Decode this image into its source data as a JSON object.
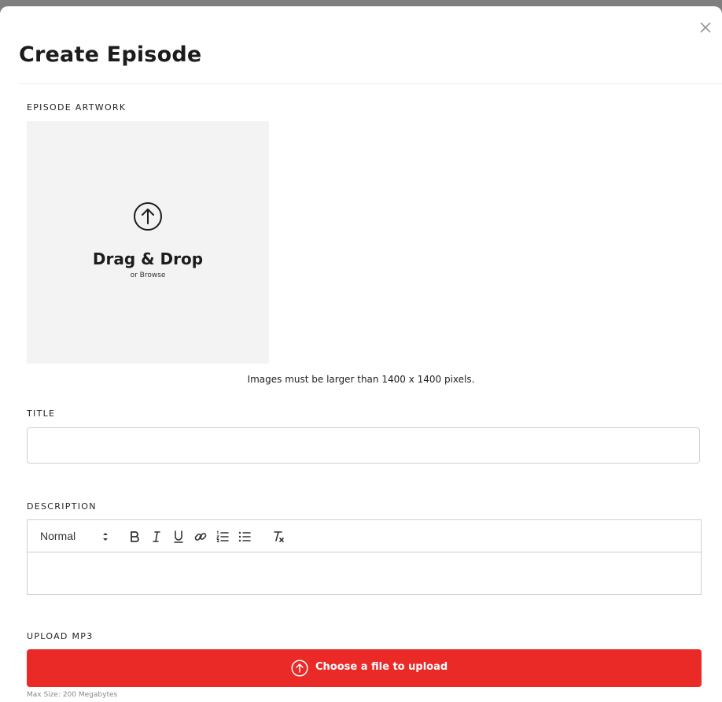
{
  "modal": {
    "title": "Create Episode",
    "close_icon": "close-icon"
  },
  "artwork": {
    "label": "EPISODE ARTWORK",
    "drop_title": "Drag & Drop",
    "drop_subtitle": "or Browse",
    "upload_icon": "upload-arrow-icon",
    "hint": "Images must be larger than 1400 x 1400 pixels."
  },
  "title_field": {
    "label": "TITLE",
    "value": "",
    "placeholder": ""
  },
  "description": {
    "label": "DESCRIPTION",
    "format_selected": "Normal",
    "toolbar_icons": [
      "bold-icon",
      "italic-icon",
      "underline-icon",
      "link-icon",
      "ordered-list-icon",
      "bullet-list-icon",
      "clear-format-icon"
    ],
    "value": ""
  },
  "upload_mp3": {
    "label": "UPLOAD MP3",
    "button_label": "Choose a file to upload",
    "max_size": "Max Size: 200 Megabytes"
  },
  "colors": {
    "accent": "#ea2a27",
    "dropzone_bg": "#f3f3f3",
    "border": "#cfcfcf"
  }
}
